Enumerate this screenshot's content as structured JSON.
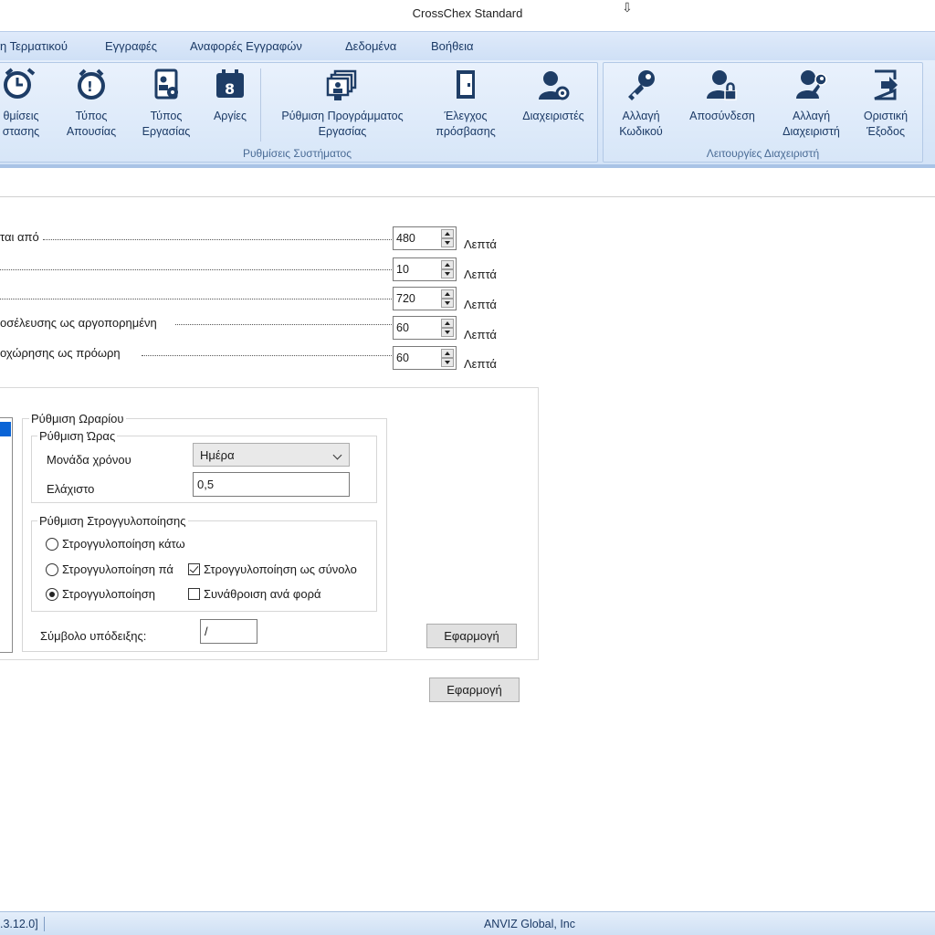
{
  "window": {
    "title": "CrossChex Standard"
  },
  "menu": [
    "η Τερματικού",
    "Εγγραφές",
    "Αναφορές Εγγραφών",
    "Δεδομένα",
    "Βοήθεια"
  ],
  "ribbon": {
    "system_group": {
      "label": "Ρυθμίσεις Συστήματος",
      "buttons": [
        {
          "line1": "θμίσεις",
          "line2": "στασης",
          "icon": "alarm-clock-icon"
        },
        {
          "line1": "Τύπος",
          "line2": "Απουσίας",
          "icon": "absence-clock-icon"
        },
        {
          "line1": "Τύπος",
          "line2": "Εργασίας",
          "icon": "work-type-badge-icon"
        },
        {
          "line1": "Αργίες",
          "line2": "",
          "icon": "calendar-icon"
        },
        {
          "line1": "Ρύθμιση Προγράμματος",
          "line2": "Εργασίας",
          "icon": "schedule-icon"
        },
        {
          "line1": "Έλεγχος",
          "line2": "πρόσβασης",
          "icon": "door-icon"
        },
        {
          "line1": "Διαχειριστές",
          "line2": "",
          "icon": "admin-gear-icon"
        }
      ]
    },
    "admin_group": {
      "label": "Λειτουργίες Διαχειριστή",
      "buttons": [
        {
          "line1": "Αλλαγή",
          "line2": "Κωδικού",
          "icon": "key-icon"
        },
        {
          "line1": "Αποσύνδεση",
          "line2": "",
          "icon": "user-lock-icon"
        },
        {
          "line1": "Αλλαγή",
          "line2": "Διαχειριστή",
          "icon": "user-key-icon"
        },
        {
          "line1": "Οριστική",
          "line2": "Έξοδος",
          "icon": "exit-icon"
        }
      ]
    }
  },
  "settings_rows": [
    {
      "label": "ται από",
      "value": "480",
      "unit": "Λεπτά"
    },
    {
      "label": "",
      "value": "10",
      "unit": "Λεπτά"
    },
    {
      "label": "",
      "value": "720",
      "unit": "Λεπτά"
    },
    {
      "label": "οσέλευσης ως αργοπορημένη",
      "value": "60",
      "unit": "Λεπτά"
    },
    {
      "label": "οχώρησης ως πρόωρη",
      "value": "60",
      "unit": "Λεπτά"
    }
  ],
  "schedule": {
    "legend": "Ρύθμιση Ωραρίου",
    "time_group": {
      "legend": "Ρύθμιση Ώρας",
      "unit_label": "Μονάδα χρόνου",
      "unit_value": "Ημέρα",
      "min_label": "Ελάχιστο",
      "min_value": "0,5"
    },
    "rounding_group": {
      "legend": "Ρύθμιση Στρογγυλοποίησης",
      "radio1": "Στρογγυλοποίηση κάτω",
      "radio2": "Στρογγυλοποίηση πά",
      "radio3": "Στρογγυλοποίηση",
      "check1": "Στρογγυλοποίηση ως σύνολο",
      "check2": "Συνάθροιση ανά φορά"
    },
    "symbol_label": "Σύμβολο υπόδειξης:",
    "symbol_value": "/",
    "apply_inner": "Εφαρμογή"
  },
  "apply_outer": "Εφαρμογή",
  "status": {
    "version": ".3.12.0]",
    "company": "ANVIZ Global, Inc"
  }
}
